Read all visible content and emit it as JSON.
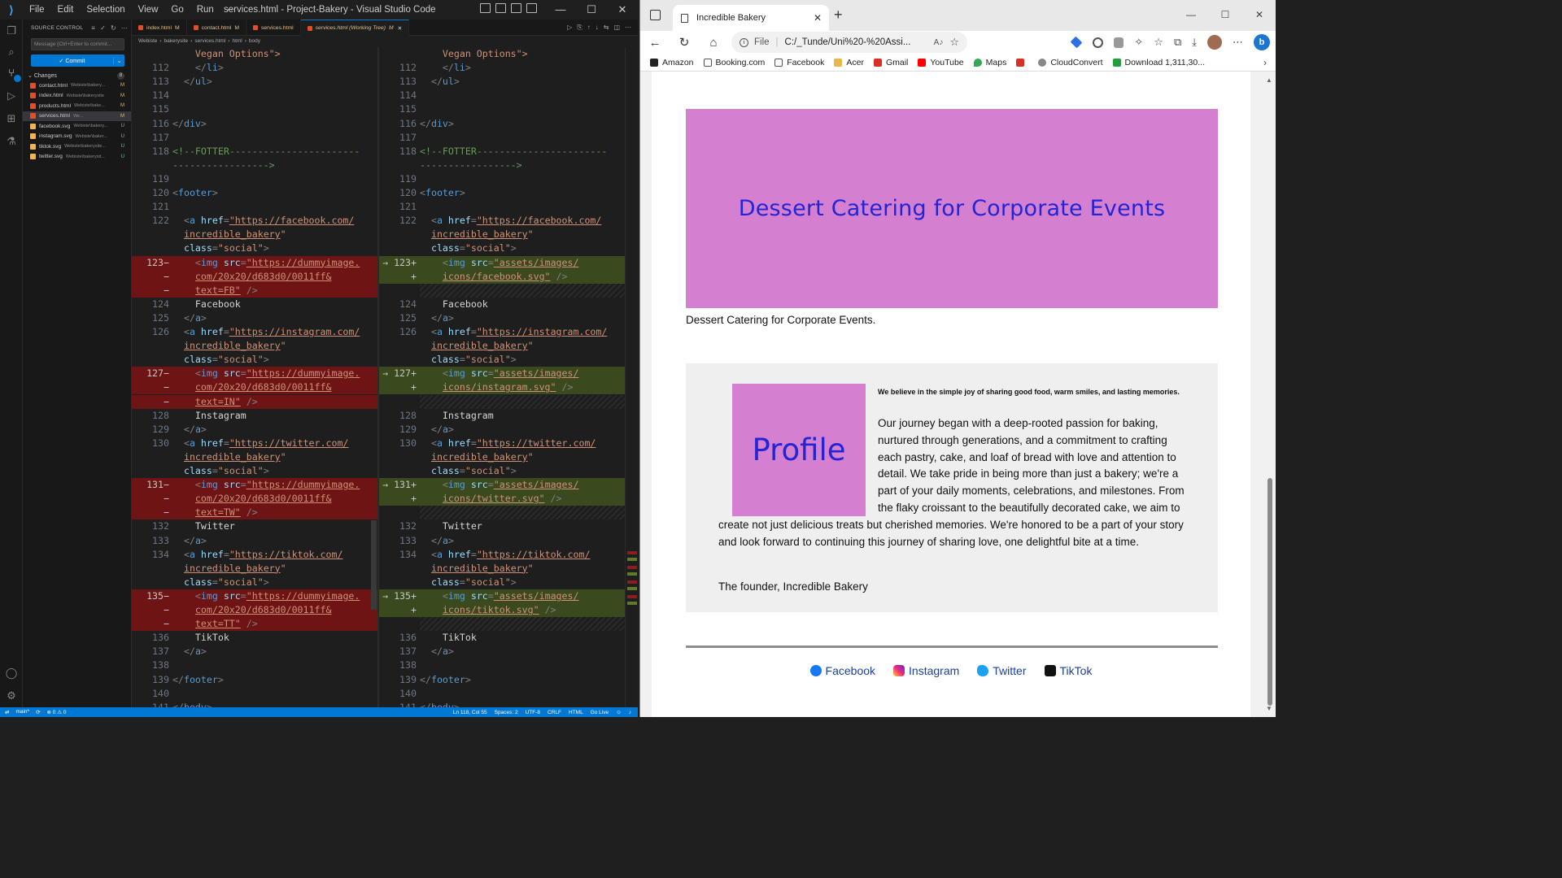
{
  "vscode": {
    "window_title": "services.html - Project-Bakery - Visual Studio Code",
    "menu": [
      "File",
      "Edit",
      "Selection",
      "View",
      "Go",
      "Run",
      "···"
    ],
    "source_control": {
      "title": "SOURCE CONTROL",
      "message_placeholder": "Message (Ctrl+Enter to commit...",
      "commit_label": "✓ Commit",
      "changes_label": "Changes",
      "changes_count": "8",
      "files": [
        {
          "name": "contact.html",
          "path": "Webiste\\bakery...",
          "status": "M",
          "kind": "h"
        },
        {
          "name": "index.html",
          "path": "Webiste\\bakerysite",
          "status": "M",
          "kind": "h"
        },
        {
          "name": "products.html",
          "path": "Webiste\\bake...",
          "status": "M",
          "kind": "h"
        },
        {
          "name": "services.html",
          "path": "We...",
          "status": "M",
          "kind": "h",
          "selected": true
        },
        {
          "name": "facebook.svg",
          "path": "Webiste\\bakery...",
          "status": "U",
          "kind": "s"
        },
        {
          "name": "instagram.svg",
          "path": "Webiste\\baker...",
          "status": "U",
          "kind": "s"
        },
        {
          "name": "tiktok.svg",
          "path": "Webiste\\bakerysite...",
          "status": "U",
          "kind": "s"
        },
        {
          "name": "twitter.svg",
          "path": "Webiste\\bakerysit...",
          "status": "U",
          "kind": "s"
        }
      ]
    },
    "tabs": [
      {
        "label": "index.html",
        "mod": "M",
        "active": false
      },
      {
        "label": "contact.html",
        "mod": "M",
        "active": false
      },
      {
        "label": "services.html",
        "mod": "",
        "active": false
      },
      {
        "label": "services.html (Working Tree)",
        "mod": "M",
        "active": true
      }
    ],
    "breadcrumbs": [
      "Webiste",
      "bakerysite",
      "services.html",
      "html",
      "body"
    ],
    "status": {
      "branch": "main*",
      "sync": "⟳",
      "problems": "⊗ 0 ⚠ 0",
      "position": "Ln 118, Col 55",
      "spaces": "Spaces: 2",
      "encoding": "UTF-8",
      "eol": "CRLF",
      "language": "HTML",
      "golive": "Go Live"
    }
  },
  "diff": {
    "left": [
      {
        "ln": "",
        "html": "<span class='c-str'>    Vegan Options\"&gt;</span>"
      },
      {
        "ln": "112",
        "html": "<span class='c-pun'>    &lt;/</span><span class='c-tag'>li</span><span class='c-pun'>&gt;</span>"
      },
      {
        "ln": "113",
        "html": "<span class='c-pun'>  &lt;/</span><span class='c-tag'>ul</span><span class='c-pun'>&gt;</span>"
      },
      {
        "ln": "114",
        "html": ""
      },
      {
        "ln": "115",
        "html": ""
      },
      {
        "ln": "116",
        "html": "<span class='c-pun'>&lt;/</span><span class='c-tag'>div</span><span class='c-pun'>&gt;</span>"
      },
      {
        "ln": "117",
        "html": ""
      },
      {
        "ln": "118",
        "html": "<span class='c-com'>&lt;!--FOTTER-----------------------</span>"
      },
      {
        "ln": "",
        "html": "<span class='c-com'>-----------------&gt;</span>"
      },
      {
        "ln": "119",
        "html": ""
      },
      {
        "ln": "120",
        "html": "<span class='c-pun'>&lt;</span><span class='c-tag'>footer</span><span class='c-pun'>&gt;</span>"
      },
      {
        "ln": "121",
        "html": ""
      },
      {
        "ln": "122",
        "html": "  <span class='c-pun'>&lt;</span><span class='c-tag'>a</span> <span class='c-att'>href</span><span class='c-pun'>=</span><span class='c-url'>\"https://facebook.com/</span>"
      },
      {
        "ln": "",
        "html": "  <span class='c-url'>incredible_bakery</span><span class='c-str'>\"</span>"
      },
      {
        "ln": "",
        "html": "  <span class='c-att'>class</span><span class='c-pun'>=</span><span class='c-str'>\"social\"</span><span class='c-pun'>&gt;</span>"
      },
      {
        "ln": "123−",
        "cls": "del",
        "diff": true,
        "html": "    <span class='c-pun'>&lt;</span><span class='c-tag'>img</span> <span class='c-att'>src</span><span class='c-pun'>=</span><span class='c-url'>\"https://dummyimage.</span>"
      },
      {
        "ln": "−",
        "cls": "del",
        "diff": true,
        "html": "    <span class='c-url'>com/20x20/d683d0/0011ff&amp;</span>"
      },
      {
        "ln": "−",
        "cls": "del",
        "diff": true,
        "html": "    <span class='c-url'>text=FB\"</span> <span class='c-pun'>/&gt;</span>"
      },
      {
        "ln": "124",
        "html": "    <span class='c-txt'>Facebook</span>"
      },
      {
        "ln": "125",
        "html": "  <span class='c-pun'>&lt;/</span><span class='c-tag'>a</span><span class='c-pun'>&gt;</span>"
      },
      {
        "ln": "126",
        "html": "  <span class='c-pun'>&lt;</span><span class='c-tag'>a</span> <span class='c-att'>href</span><span class='c-pun'>=</span><span class='c-url'>\"https://instagram.com/</span>"
      },
      {
        "ln": "",
        "html": "  <span class='c-url'>incredible_bakery</span><span class='c-str'>\"</span>"
      },
      {
        "ln": "",
        "html": "  <span class='c-att'>class</span><span class='c-pun'>=</span><span class='c-str'>\"social\"</span><span class='c-pun'>&gt;</span>"
      },
      {
        "ln": "127−",
        "cls": "del",
        "diff": true,
        "html": "    <span class='c-pun'>&lt;</span><span class='c-tag'>img</span> <span class='c-att'>src</span><span class='c-pun'>=</span><span class='c-url'>\"https://dummyimage.</span>"
      },
      {
        "ln": "−",
        "cls": "del",
        "diff": true,
        "html": "    <span class='c-url'>com/20x20/d683d0/0011ff&amp;</span>"
      },
      {
        "ln": "−",
        "cls": "del",
        "diff": true,
        "html": "    <span class='c-url'>text=IN\"</span> <span class='c-pun'>/&gt;</span>"
      },
      {
        "ln": "128",
        "html": "    <span class='c-txt'>Instagram</span>"
      },
      {
        "ln": "129",
        "html": "  <span class='c-pun'>&lt;/</span><span class='c-tag'>a</span><span class='c-pun'>&gt;</span>"
      },
      {
        "ln": "130",
        "html": "  <span class='c-pun'>&lt;</span><span class='c-tag'>a</span> <span class='c-att'>href</span><span class='c-pun'>=</span><span class='c-url'>\"https://twitter.com/</span>"
      },
      {
        "ln": "",
        "html": "  <span class='c-url'>incredible_bakery</span><span class='c-str'>\"</span>"
      },
      {
        "ln": "",
        "html": "  <span class='c-att'>class</span><span class='c-pun'>=</span><span class='c-str'>\"social\"</span><span class='c-pun'>&gt;</span>"
      },
      {
        "ln": "131−",
        "cls": "del",
        "diff": true,
        "html": "    <span class='c-pun'>&lt;</span><span class='c-tag'>img</span> <span class='c-att'>src</span><span class='c-pun'>=</span><span class='c-url'>\"https://dummyimage.</span>"
      },
      {
        "ln": "−",
        "cls": "del",
        "diff": true,
        "html": "    <span class='c-url'>com/20x20/d683d0/0011ff&amp;</span>"
      },
      {
        "ln": "−",
        "cls": "del",
        "diff": true,
        "html": "    <span class='c-url'>text=TW\"</span> <span class='c-pun'>/&gt;</span>"
      },
      {
        "ln": "132",
        "html": "    <span class='c-txt'>Twitter</span>"
      },
      {
        "ln": "133",
        "html": "  <span class='c-pun'>&lt;/</span><span class='c-tag'>a</span><span class='c-pun'>&gt;</span>"
      },
      {
        "ln": "134",
        "html": "  <span class='c-pun'>&lt;</span><span class='c-tag'>a</span> <span class='c-att'>href</span><span class='c-pun'>=</span><span class='c-url'>\"https://tiktok.com/</span>"
      },
      {
        "ln": "",
        "html": "  <span class='c-url'>incredible_bakery</span><span class='c-str'>\"</span>"
      },
      {
        "ln": "",
        "html": "  <span class='c-att'>class</span><span class='c-pun'>=</span><span class='c-str'>\"social\"</span><span class='c-pun'>&gt;</span>"
      },
      {
        "ln": "135−",
        "cls": "del",
        "diff": true,
        "html": "    <span class='c-pun'>&lt;</span><span class='c-tag'>img</span> <span class='c-att'>src</span><span class='c-pun'>=</span><span class='c-url'>\"https://dummyimage.</span>"
      },
      {
        "ln": "−",
        "cls": "del",
        "diff": true,
        "html": "    <span class='c-url'>com/20x20/d683d0/0011ff&amp;</span>"
      },
      {
        "ln": "−",
        "cls": "del",
        "diff": true,
        "html": "    <span class='c-url'>text=TT\"</span> <span class='c-pun'>/&gt;</span>"
      },
      {
        "ln": "136",
        "html": "    <span class='c-txt'>TikTok</span>"
      },
      {
        "ln": "137",
        "html": "  <span class='c-pun'>&lt;/</span><span class='c-tag'>a</span><span class='c-pun'>&gt;</span>"
      },
      {
        "ln": "138",
        "html": ""
      },
      {
        "ln": "139",
        "html": "<span class='c-pun'>&lt;/</span><span class='c-tag'>footer</span><span class='c-pun'>&gt;</span>"
      },
      {
        "ln": "140",
        "html": ""
      },
      {
        "ln": "141",
        "html": "<span class='c-pun'>&lt;/</span><span class='c-tag'>body</span><span class='c-pun'>&gt;</span>"
      }
    ],
    "right": [
      {
        "ln": "",
        "html": "<span class='c-str'>    Vegan Options\"&gt;</span>"
      },
      {
        "ln": "112",
        "html": "<span class='c-pun'>    &lt;/</span><span class='c-tag'>li</span><span class='c-pun'>&gt;</span>"
      },
      {
        "ln": "113",
        "html": "<span class='c-pun'>  &lt;/</span><span class='c-tag'>ul</span><span class='c-pun'>&gt;</span>"
      },
      {
        "ln": "114",
        "html": ""
      },
      {
        "ln": "115",
        "html": ""
      },
      {
        "ln": "116",
        "html": "<span class='c-pun'>&lt;/</span><span class='c-tag'>div</span><span class='c-pun'>&gt;</span>"
      },
      {
        "ln": "117",
        "html": ""
      },
      {
        "ln": "118",
        "html": "<span class='c-com'>&lt;!--FOTTER-----------------------</span>"
      },
      {
        "ln": "",
        "html": "<span class='c-com'>-----------------&gt;</span>"
      },
      {
        "ln": "119",
        "html": ""
      },
      {
        "ln": "120",
        "html": "<span class='c-pun'>&lt;</span><span class='c-tag'>footer</span><span class='c-pun'>&gt;</span>"
      },
      {
        "ln": "121",
        "html": ""
      },
      {
        "ln": "122",
        "html": "  <span class='c-pun'>&lt;</span><span class='c-tag'>a</span> <span class='c-att'>href</span><span class='c-pun'>=</span><span class='c-url'>\"https://facebook.com/</span>"
      },
      {
        "ln": "",
        "html": "  <span class='c-url'>incredible_bakery</span><span class='c-str'>\"</span>"
      },
      {
        "ln": "",
        "html": "  <span class='c-att'>class</span><span class='c-pun'>=</span><span class='c-str'>\"social\"</span><span class='c-pun'>&gt;</span>"
      },
      {
        "ln": "→ 123+",
        "cls": "add",
        "diff": true,
        "html": "    <span class='c-pun'>&lt;</span><span class='c-tag'>img</span> <span class='c-att'>src</span><span class='c-pun'>=</span><span class='c-url'>\"assets/images/</span>"
      },
      {
        "ln": "+",
        "cls": "add",
        "diff": true,
        "html": "    <span class='c-url'>icons/facebook.svg\"</span> <span class='c-pun'>/&gt;</span>"
      },
      {
        "ln": "",
        "cls": "hatch",
        "html": ""
      },
      {
        "ln": "124",
        "html": "    <span class='c-txt'>Facebook</span>"
      },
      {
        "ln": "125",
        "html": "  <span class='c-pun'>&lt;/</span><span class='c-tag'>a</span><span class='c-pun'>&gt;</span>"
      },
      {
        "ln": "126",
        "html": "  <span class='c-pun'>&lt;</span><span class='c-tag'>a</span> <span class='c-att'>href</span><span class='c-pun'>=</span><span class='c-url'>\"https://instagram.com/</span>"
      },
      {
        "ln": "",
        "html": "  <span class='c-url'>incredible_bakery</span><span class='c-str'>\"</span>"
      },
      {
        "ln": "",
        "html": "  <span class='c-att'>class</span><span class='c-pun'>=</span><span class='c-str'>\"social\"</span><span class='c-pun'>&gt;</span>"
      },
      {
        "ln": "→ 127+",
        "cls": "add",
        "diff": true,
        "html": "    <span class='c-pun'>&lt;</span><span class='c-tag'>img</span> <span class='c-att'>src</span><span class='c-pun'>=</span><span class='c-url'>\"assets/images/</span>"
      },
      {
        "ln": "+",
        "cls": "add",
        "diff": true,
        "html": "    <span class='c-url'>icons/instagram.svg\"</span> <span class='c-pun'>/&gt;</span>"
      },
      {
        "ln": "",
        "cls": "hatch",
        "html": ""
      },
      {
        "ln": "128",
        "html": "    <span class='c-txt'>Instagram</span>"
      },
      {
        "ln": "129",
        "html": "  <span class='c-pun'>&lt;/</span><span class='c-tag'>a</span><span class='c-pun'>&gt;</span>"
      },
      {
        "ln": "130",
        "html": "  <span class='c-pun'>&lt;</span><span class='c-tag'>a</span> <span class='c-att'>href</span><span class='c-pun'>=</span><span class='c-url'>\"https://twitter.com/</span>"
      },
      {
        "ln": "",
        "html": "  <span class='c-url'>incredible_bakery</span><span class='c-str'>\"</span>"
      },
      {
        "ln": "",
        "html": "  <span class='c-att'>class</span><span class='c-pun'>=</span><span class='c-str'>\"social\"</span><span class='c-pun'>&gt;</span>"
      },
      {
        "ln": "→ 131+",
        "cls": "add",
        "diff": true,
        "html": "    <span class='c-pun'>&lt;</span><span class='c-tag'>img</span> <span class='c-att'>src</span><span class='c-pun'>=</span><span class='c-url'>\"assets/images/</span>"
      },
      {
        "ln": "+",
        "cls": "add",
        "diff": true,
        "html": "    <span class='c-url'>icons/twitter.svg\"</span> <span class='c-pun'>/&gt;</span>"
      },
      {
        "ln": "",
        "cls": "hatch",
        "html": ""
      },
      {
        "ln": "132",
        "html": "    <span class='c-txt'>Twitter</span>"
      },
      {
        "ln": "133",
        "html": "  <span class='c-pun'>&lt;/</span><span class='c-tag'>a</span><span class='c-pun'>&gt;</span>"
      },
      {
        "ln": "134",
        "html": "  <span class='c-pun'>&lt;</span><span class='c-tag'>a</span> <span class='c-att'>href</span><span class='c-pun'>=</span><span class='c-url'>\"https://tiktok.com/</span>"
      },
      {
        "ln": "",
        "html": "  <span class='c-url'>incredible_bakery</span><span class='c-str'>\"</span>"
      },
      {
        "ln": "",
        "html": "  <span class='c-att'>class</span><span class='c-pun'>=</span><span class='c-str'>\"social\"</span><span class='c-pun'>&gt;</span>"
      },
      {
        "ln": "→ 135+",
        "cls": "add",
        "diff": true,
        "html": "    <span class='c-pun'>&lt;</span><span class='c-tag'>img</span> <span class='c-att'>src</span><span class='c-pun'>=</span><span class='c-url'>\"assets/images/</span>"
      },
      {
        "ln": "+",
        "cls": "add",
        "diff": true,
        "html": "    <span class='c-url'>icons/tiktok.svg\"</span> <span class='c-pun'>/&gt;</span>"
      },
      {
        "ln": "",
        "cls": "hatch",
        "html": ""
      },
      {
        "ln": "136",
        "html": "    <span class='c-txt'>TikTok</span>"
      },
      {
        "ln": "137",
        "html": "  <span class='c-pun'>&lt;/</span><span class='c-tag'>a</span><span class='c-pun'>&gt;</span>"
      },
      {
        "ln": "138",
        "html": ""
      },
      {
        "ln": "139",
        "html": "<span class='c-pun'>&lt;/</span><span class='c-tag'>footer</span><span class='c-pun'>&gt;</span>"
      },
      {
        "ln": "140",
        "html": ""
      },
      {
        "ln": "141",
        "html": "<span class='c-pun'>&lt;/</span><span class='c-tag'>body</span><span class='c-pun'>&gt;</span>"
      }
    ]
  },
  "browser": {
    "tab_title": "Incredible Bakery",
    "address_scheme": "File",
    "address": "C:/_Tunde/Uni%20-%20Assi...",
    "read_aloud": "Aͅ",
    "favorites": [
      {
        "label": "Amazon",
        "icon": "amz"
      },
      {
        "label": "Booking.com",
        "icon": "doc"
      },
      {
        "label": "Facebook",
        "icon": "doc"
      },
      {
        "label": "Acer",
        "icon": "fold"
      },
      {
        "label": "Gmail",
        "icon": "gm"
      },
      {
        "label": "YouTube",
        "icon": "yt"
      },
      {
        "label": "Maps",
        "icon": "mp"
      },
      {
        "label": "",
        "icon": "gm"
      },
      {
        "label": "CloudConvert",
        "icon": "cc"
      },
      {
        "label": "Download 1,311,30...",
        "icon": "dl"
      }
    ],
    "page": {
      "hero_text": "Dessert Catering for Corporate Events",
      "caption": "Dessert Catering for Corporate Events.",
      "profile_text": "Profile",
      "belief": "We believe in the simple joy of sharing good food, warm smiles, and lasting memories.",
      "story": "Our journey began with a deep-rooted passion for baking, nurtured through generations, and a commitment to crafting each pastry, cake, and loaf of bread with love and attention to detail. We take pride in being more than just a bakery; we're a part of your daily moments, celebrations, and milestones. From the flaky croissant to the beautifully decorated cake, we aim to create not just delicious treats but cherished memories. We're honored to be a part of your story and look forward to continuing this journey of sharing love, one delightful bite at a time.",
      "signoff": "The founder, Incredible Bakery",
      "footer_links": [
        {
          "label": "Facebook",
          "icon": "fb"
        },
        {
          "label": "Instagram",
          "icon": "ig"
        },
        {
          "label": "Twitter",
          "icon": "tw"
        },
        {
          "label": "TikTok",
          "icon": "tt"
        }
      ]
    }
  },
  "colors": {
    "vscode_bg": "#1e1e1e",
    "accent": "#0078d4",
    "deleted": "#6e1414",
    "added": "#3a4a1e",
    "placeholder_pink": "#d47fd0",
    "placeholder_text": "#2424d4"
  }
}
